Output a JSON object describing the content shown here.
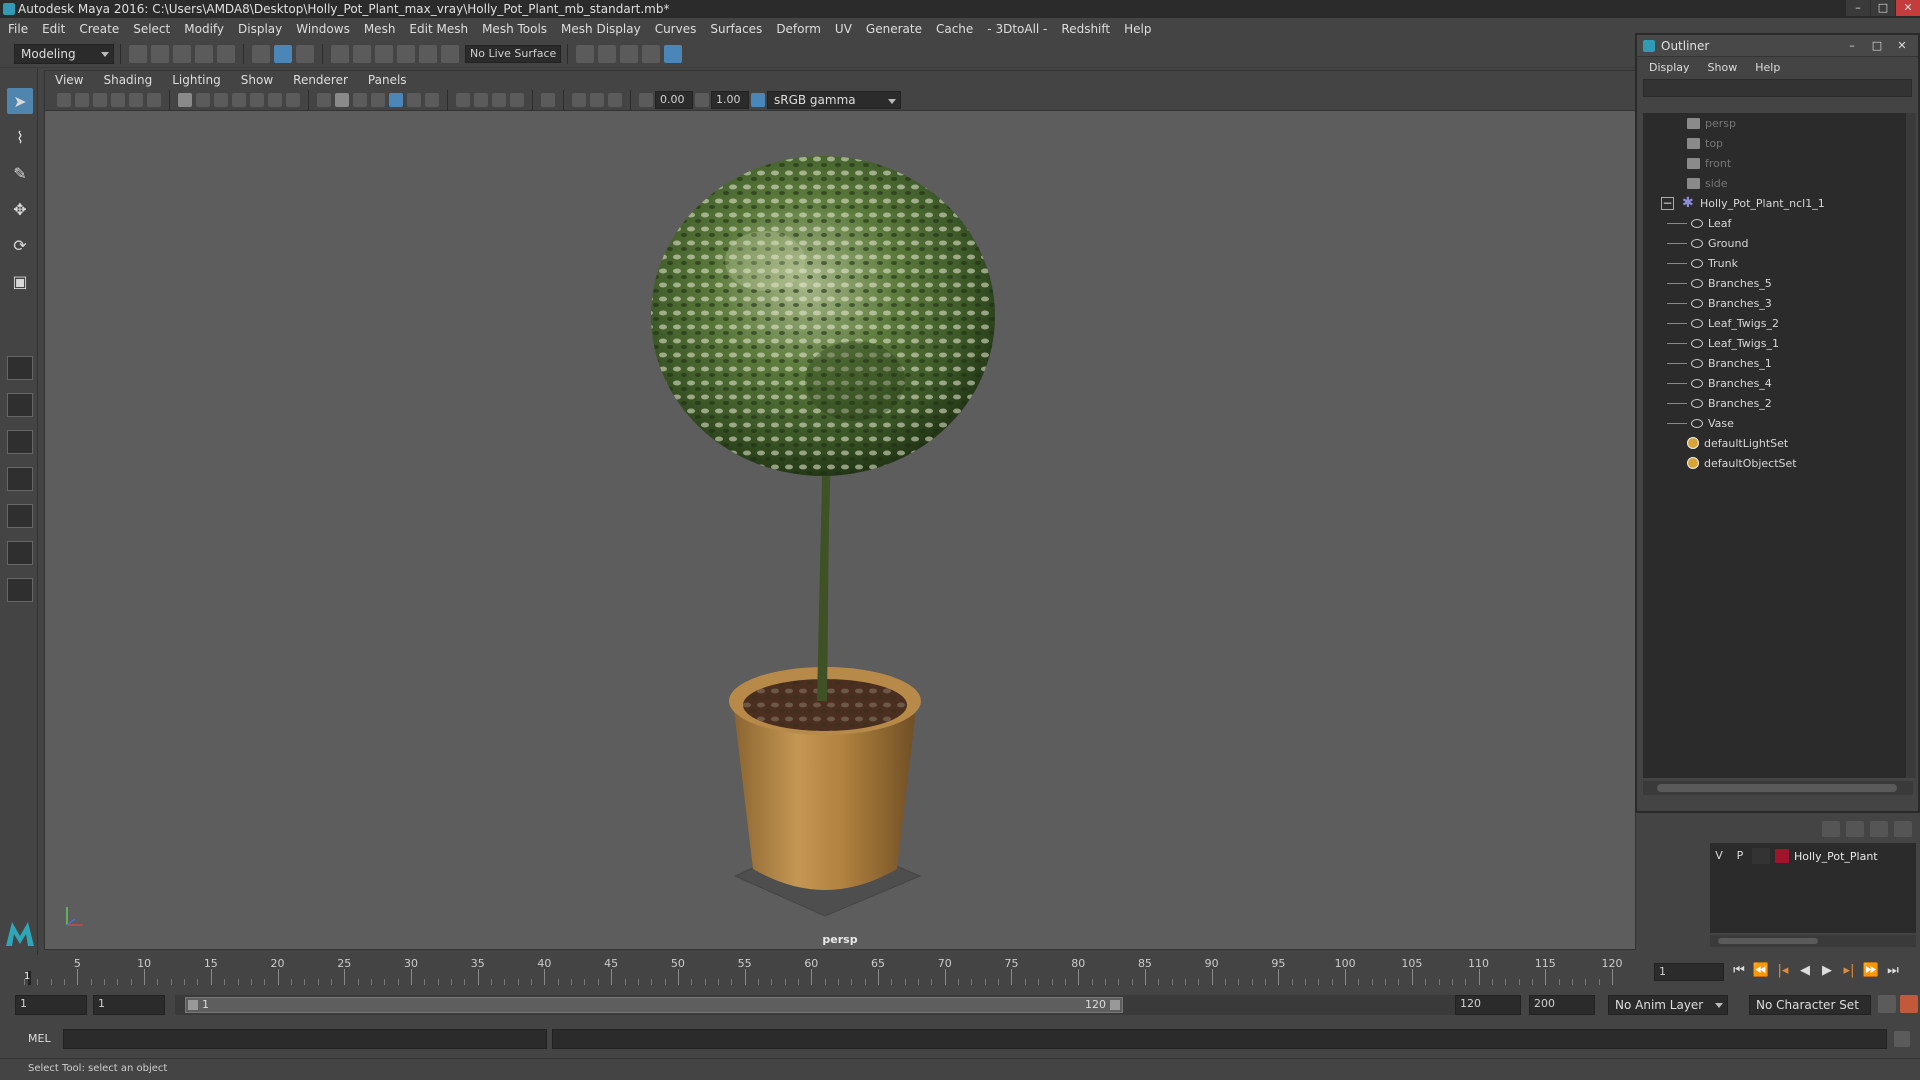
{
  "app": {
    "title": "Autodesk Maya 2016: C:\\Users\\AMDA8\\Desktop\\Holly_Pot_Plant_max_vray\\Holly_Pot_Plant_mb_standart.mb*"
  },
  "menubar": [
    "File",
    "Edit",
    "Create",
    "Select",
    "Modify",
    "Display",
    "Windows",
    "Mesh",
    "Edit Mesh",
    "Mesh Tools",
    "Mesh Display",
    "Curves",
    "Surfaces",
    "Deform",
    "UV",
    "Generate",
    "Cache",
    "- 3DtoAll -",
    "Redshift",
    "Help"
  ],
  "statusline": {
    "mode": "Modeling",
    "live_surface": "No Live Surface"
  },
  "viewport": {
    "menu": [
      "View",
      "Shading",
      "Lighting",
      "Show",
      "Renderer",
      "Panels"
    ],
    "exposure": "0.00",
    "gamma": "1.00",
    "colorspace": "sRGB gamma",
    "camera": "persp"
  },
  "outliner": {
    "title": "Outliner",
    "menu": [
      "Display",
      "Show",
      "Help"
    ],
    "items": [
      {
        "name": "persp",
        "type": "camera"
      },
      {
        "name": "top",
        "type": "camera"
      },
      {
        "name": "front",
        "type": "camera"
      },
      {
        "name": "side",
        "type": "camera"
      },
      {
        "name": "Holly_Pot_Plant_ncl1_1",
        "type": "group",
        "expanded": true
      },
      {
        "name": "Leaf",
        "type": "mesh"
      },
      {
        "name": "Ground",
        "type": "mesh"
      },
      {
        "name": "Trunk",
        "type": "mesh"
      },
      {
        "name": "Branches_5",
        "type": "mesh"
      },
      {
        "name": "Branches_3",
        "type": "mesh"
      },
      {
        "name": "Leaf_Twigs_2",
        "type": "mesh"
      },
      {
        "name": "Leaf_Twigs_1",
        "type": "mesh"
      },
      {
        "name": "Branches_1",
        "type": "mesh"
      },
      {
        "name": "Branches_4",
        "type": "mesh"
      },
      {
        "name": "Branches_2",
        "type": "mesh"
      },
      {
        "name": "Vase",
        "type": "mesh"
      },
      {
        "name": "defaultLightSet",
        "type": "set"
      },
      {
        "name": "defaultObjectSet",
        "type": "set"
      }
    ]
  },
  "layers": {
    "visible": "V",
    "playback": "P",
    "name": "Holly_Pot_Plant",
    "color": "#a0142c"
  },
  "timeslider": {
    "labels": [
      "5",
      "10",
      "15",
      "20",
      "25",
      "30",
      "35",
      "40",
      "45",
      "50",
      "55",
      "60",
      "65",
      "70",
      "75",
      "80",
      "85",
      "90",
      "95",
      "100",
      "105",
      "110",
      "115",
      "120"
    ],
    "current_marker": "1",
    "current_frame": "1"
  },
  "rangeslider": {
    "start": "1",
    "playback_start": "1",
    "thumb_start": "1",
    "thumb_end": "120",
    "playback_end": "120",
    "end": "200",
    "anim_layer": "No Anim Layer",
    "character_set": "No Character Set"
  },
  "cmdline": {
    "label": "MEL"
  },
  "helpline": "Select Tool: select an object",
  "colors": {
    "accent": "#5085b0",
    "viewport_bg": "#5d5d5d",
    "key": "#e08a3a"
  }
}
